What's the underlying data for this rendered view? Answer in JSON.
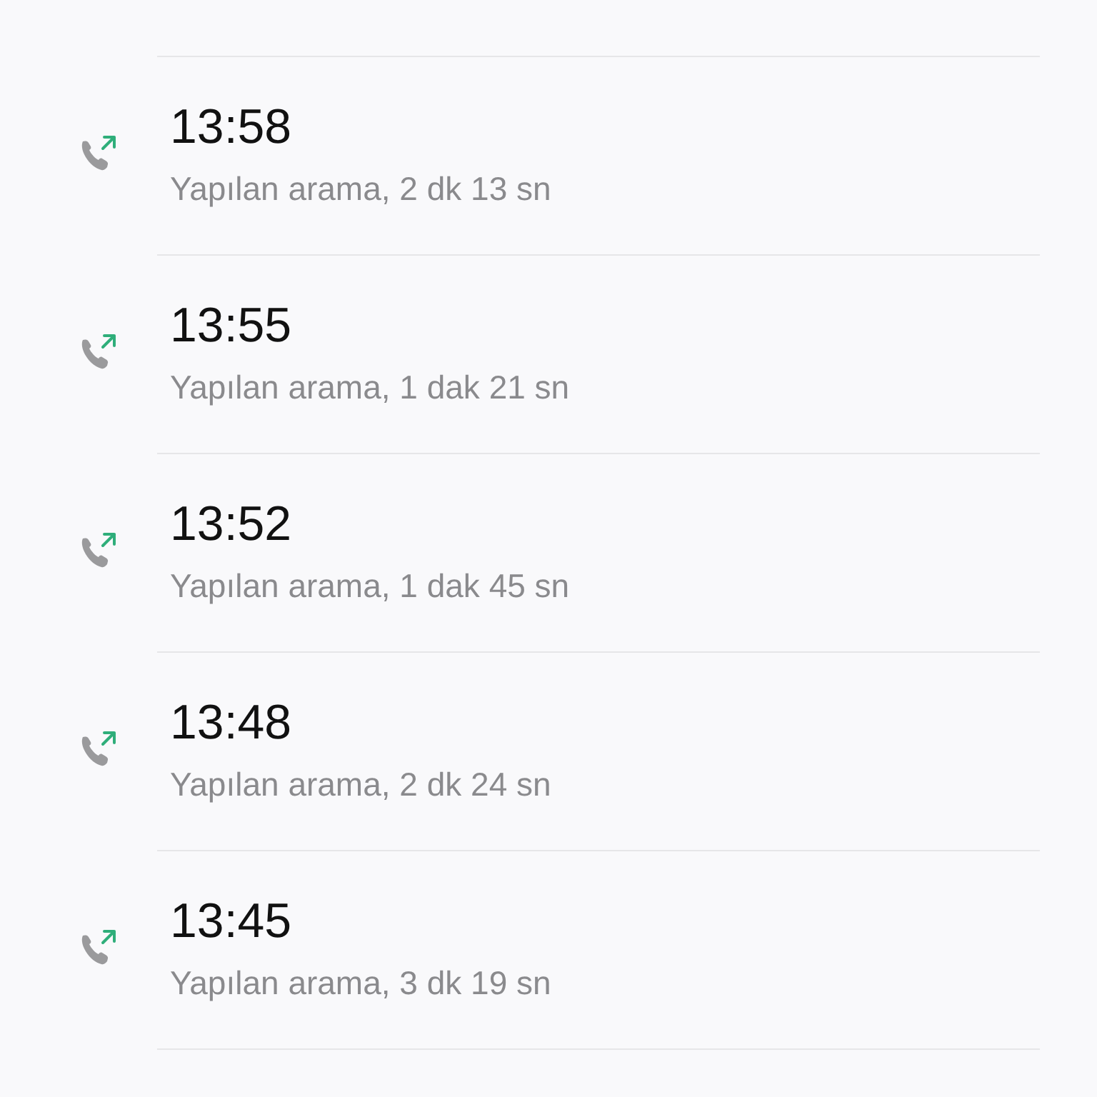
{
  "calls": [
    {
      "time": "13:58",
      "detail": "Yapılan arama, 2 dk 13 sn",
      "kind": "outgoing"
    },
    {
      "time": "13:55",
      "detail": "Yapılan arama, 1 dak 21 sn",
      "kind": "outgoing"
    },
    {
      "time": "13:52",
      "detail": "Yapılan arama, 1 dak 45 sn",
      "kind": "outgoing"
    },
    {
      "time": "13:48",
      "detail": "Yapılan arama, 2 dk 24 sn",
      "kind": "outgoing"
    },
    {
      "time": "13:45",
      "detail": "Yapılan arama, 3 dk 19 sn",
      "kind": "outgoing"
    }
  ]
}
